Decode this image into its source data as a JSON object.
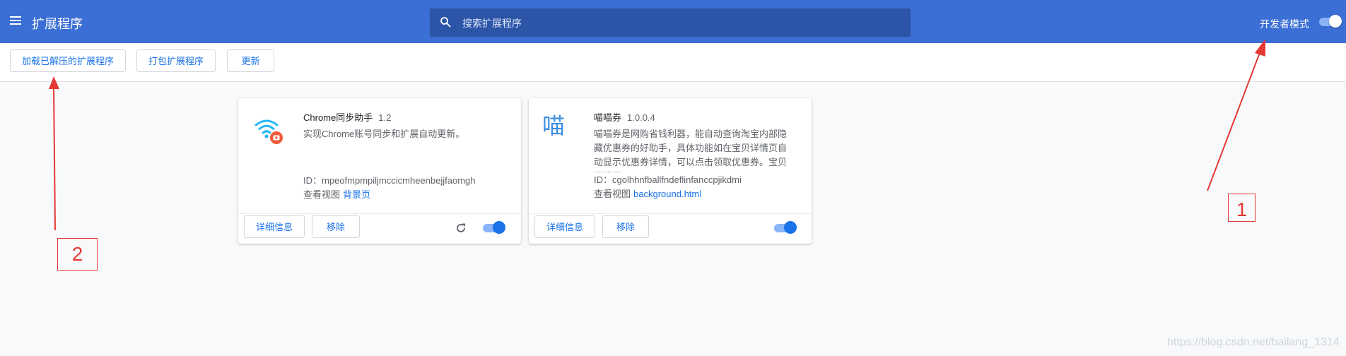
{
  "header": {
    "title": "扩展程序",
    "search_placeholder": "搜索扩展程序",
    "developer_mode_label": "开发者模式",
    "developer_mode_on": true,
    "color": "#3b6fd5"
  },
  "toolbar": {
    "load_unpacked": "加载已解压的扩展程序",
    "pack_extension": "打包扩展程序",
    "update": "更新"
  },
  "extensions": [
    {
      "name": "Chrome同步助手",
      "version": "1.2",
      "description": "实现Chrome账号同步和扩展自动更新。",
      "id_label": "ID：",
      "id": "mpeofmpmpiljmccicmheenbejjfaomgh",
      "view_label": "查看视图",
      "view_link": "背景页",
      "details_label": "详细信息",
      "remove_label": "移除",
      "enabled": true,
      "icon": "wifi-sync-icon"
    },
    {
      "name": "喵喵券",
      "version": "1.0.0.4",
      "icon_glyph": "喵",
      "description": "喵喵券是网购省钱利器，能自动查询淘宝内部隐藏优惠券的好助手，具体功能如在宝贝详情页自动显示优惠券详情，可以点击领取优惠券。宝贝详情页",
      "id_label": "ID：",
      "id": "cgolhhnfballfndeflinfanccpjikdmi",
      "view_label": "查看视图",
      "view_link": "background.html",
      "details_label": "详细信息",
      "remove_label": "移除",
      "enabled": true,
      "icon": "meow-text-icon"
    }
  ],
  "annotations": {
    "box1": "1",
    "box2": "2",
    "color": "#e53935"
  },
  "watermark": "https://blog.csdn.net/bailang_1314"
}
